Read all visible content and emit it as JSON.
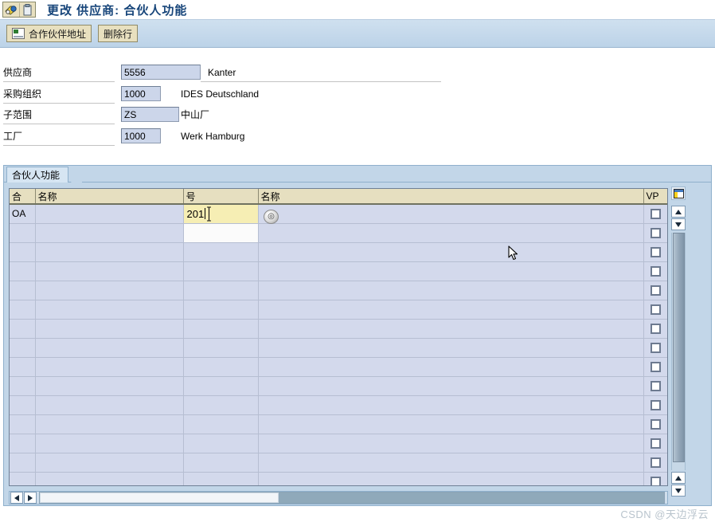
{
  "window": {
    "title": "更改 供应商: 合伙人功能",
    "sys_icon_1": "sap-partner-icon",
    "sys_icon_2": "clipboard-icon"
  },
  "toolbar": {
    "buttons": [
      {
        "label": "合作伙伴地址",
        "icon": "address-card-icon"
      },
      {
        "label": "删除行",
        "icon": "none"
      }
    ]
  },
  "form": {
    "rows": [
      {
        "label": "供应商",
        "value": "5556",
        "desc": "Kanter"
      },
      {
        "label": "采购组织",
        "value": "1000",
        "desc": "IDES Deutschland"
      },
      {
        "label": "子范围",
        "value": "ZS",
        "desc": "中山厂"
      },
      {
        "label": "工厂",
        "value": "1000",
        "desc": "Werk Hamburg"
      }
    ]
  },
  "tabs": {
    "active": "合伙人功能"
  },
  "grid": {
    "columns": [
      "合",
      "名称",
      "号",
      "名称",
      "VP"
    ],
    "editing_value": "201",
    "rows": [
      {
        "fn": "OA",
        "name": "",
        "num": "201",
        "num2name": "",
        "vp": false,
        "editing": true
      },
      {
        "fn": "",
        "name": "",
        "num": "",
        "num2name": "",
        "vp": false,
        "editing": false
      },
      {
        "fn": "",
        "name": "",
        "num": "",
        "num2name": "",
        "vp": false,
        "editing": false
      },
      {
        "fn": "",
        "name": "",
        "num": "",
        "num2name": "",
        "vp": false,
        "editing": false
      },
      {
        "fn": "",
        "name": "",
        "num": "",
        "num2name": "",
        "vp": false,
        "editing": false
      },
      {
        "fn": "",
        "name": "",
        "num": "",
        "num2name": "",
        "vp": false,
        "editing": false
      },
      {
        "fn": "",
        "name": "",
        "num": "",
        "num2name": "",
        "vp": false,
        "editing": false
      },
      {
        "fn": "",
        "name": "",
        "num": "",
        "num2name": "",
        "vp": false,
        "editing": false
      },
      {
        "fn": "",
        "name": "",
        "num": "",
        "num2name": "",
        "vp": false,
        "editing": false
      },
      {
        "fn": "",
        "name": "",
        "num": "",
        "num2name": "",
        "vp": false,
        "editing": false
      },
      {
        "fn": "",
        "name": "",
        "num": "",
        "num2name": "",
        "vp": false,
        "editing": false
      },
      {
        "fn": "",
        "name": "",
        "num": "",
        "num2name": "",
        "vp": false,
        "editing": false
      },
      {
        "fn": "",
        "name": "",
        "num": "",
        "num2name": "",
        "vp": false,
        "editing": false
      },
      {
        "fn": "",
        "name": "",
        "num": "",
        "num2name": "",
        "vp": false,
        "editing": false
      },
      {
        "fn": "",
        "name": "",
        "num": "",
        "num2name": "",
        "vp": false,
        "editing": false
      }
    ]
  },
  "controls": {
    "f4_help": "search-help-button",
    "table_settings": "table-settings-icon",
    "scroll_up": "▲",
    "scroll_down": "▼",
    "scroll_left": "◀",
    "scroll_right": "▶"
  },
  "watermark": {
    "text": "CSDN @天边浮云"
  },
  "colors": {
    "title_blue": "#17457a",
    "toolbar_blue": "#c3d7ea",
    "header_tan": "#e6dfc0",
    "row_lavender": "#d3d9ec",
    "edit_yellow": "#f6eeb4",
    "panel_blue": "#c2d6e8"
  }
}
